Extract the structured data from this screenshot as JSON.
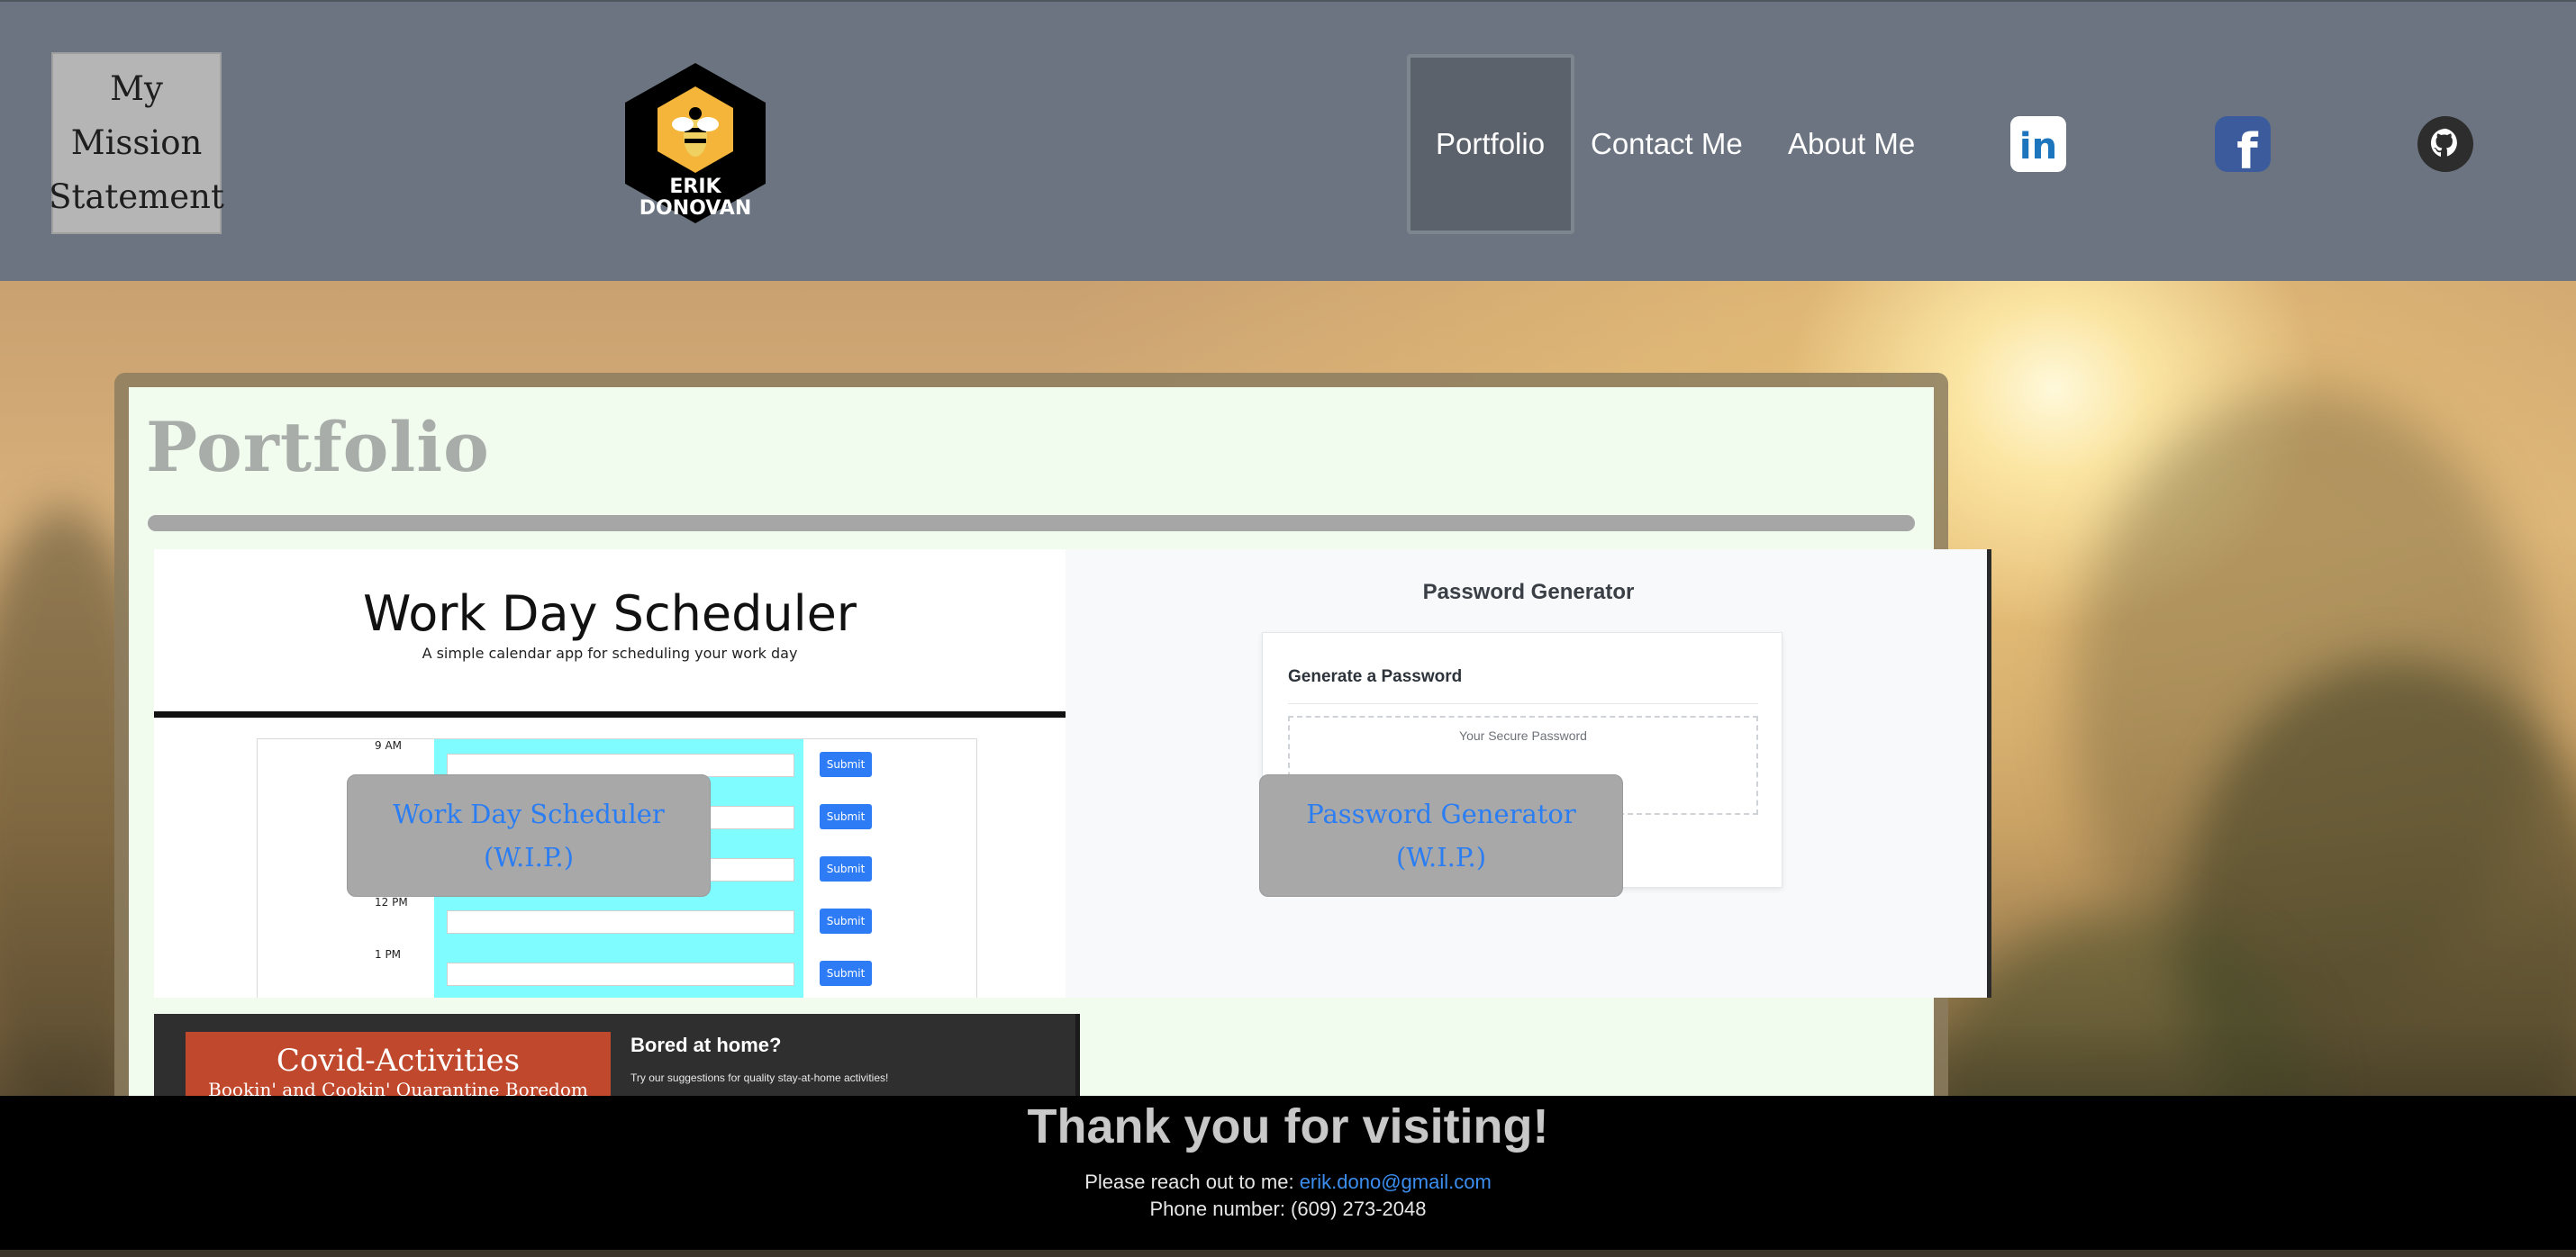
{
  "header": {
    "mission_lines": [
      "My",
      "Mission",
      "Statement"
    ],
    "logo_text_line1": "ERIK",
    "logo_text_line2": "DONOVAN",
    "nav": [
      {
        "label": "Portfolio",
        "active": true
      },
      {
        "label": "Contact Me"
      },
      {
        "label": "About Me"
      }
    ],
    "social": [
      {
        "name": "linkedin-icon",
        "glyph": "in"
      },
      {
        "name": "facebook-icon",
        "glyph": "f"
      },
      {
        "name": "github-icon"
      }
    ]
  },
  "portfolio": {
    "title": "Portfolio",
    "projects": [
      {
        "overlay_line1": "Work Day Scheduler",
        "overlay_line2": "(W.I.P.)",
        "preview": {
          "title": "Work Day Scheduler",
          "subtitle": "A simple calendar app for scheduling your work day",
          "hours": [
            "9 AM",
            "",
            "",
            "12 PM",
            "1 PM"
          ],
          "button": "Submit"
        }
      },
      {
        "overlay_line1": "Password Generator",
        "overlay_line2": "(W.I.P.)",
        "preview": {
          "title": "Password Generator",
          "card_title": "Generate a Password",
          "placeholder": "Your Secure Password"
        }
      },
      {
        "preview": {
          "title": "Covid-Activities",
          "subtitle": "Bookin' and Cookin' Quarantine Boredom",
          "heading": "Bored at home?",
          "small": "Try our suggestions for quality stay-at-home activities!"
        }
      }
    ]
  },
  "footer": {
    "thanks": "Thank you for visiting!",
    "reach_prefix": "Please reach out to me:",
    "email": "erik.dono@gmail.com",
    "phone": "Phone number: (609) 273-2048"
  },
  "colors": {
    "header_bg": "#6b7480",
    "card_bg": "#f1fbee",
    "link_blue": "#2a7df3",
    "footer_bg": "#000000"
  }
}
